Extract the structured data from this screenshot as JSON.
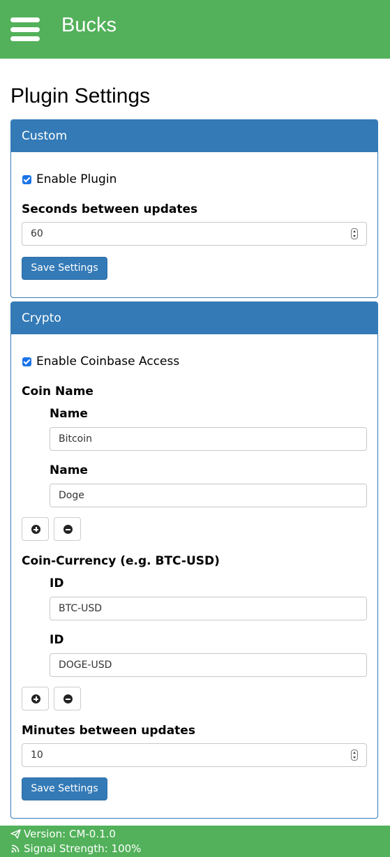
{
  "navbar": {
    "brand": "Bucks",
    "menu_icon": "hamburger-menu-icon",
    "background": "#52b15a"
  },
  "page_title": "Plugin Settings",
  "custom_panel": {
    "heading": "Custom",
    "enable_label": "Enable Plugin",
    "enable_checked": true,
    "seconds_label": "Seconds between updates",
    "seconds_value": "60",
    "save_label": "Save Settings"
  },
  "crypto_panel": {
    "heading": "Crypto",
    "enable_label": "Enable Coinbase Access",
    "enable_checked": true,
    "coin_name_label": "Coin Name",
    "coin_names": [
      {
        "label": "Name",
        "value": "Bitcoin"
      },
      {
        "label": "Name",
        "value": "Doge"
      }
    ],
    "coin_currency_label": "Coin-Currency (e.g. BTC-USD)",
    "coin_currencies": [
      {
        "label": "ID",
        "value": "BTC-USD"
      },
      {
        "label": "ID",
        "value": "DOGE-USD"
      }
    ],
    "minutes_label": "Minutes between updates",
    "minutes_value": "10",
    "save_label": "Save Settings"
  },
  "footer": {
    "version": "Version: CM-0.1.0",
    "signal": "Signal Strength: 100%",
    "version_icon": "paper-plane-icon",
    "signal_icon": "rss-signal-icon"
  },
  "colors": {
    "accent_green": "#52b15a",
    "panel_blue": "#337ab7",
    "checkbox_blue": "#1a73e8"
  }
}
